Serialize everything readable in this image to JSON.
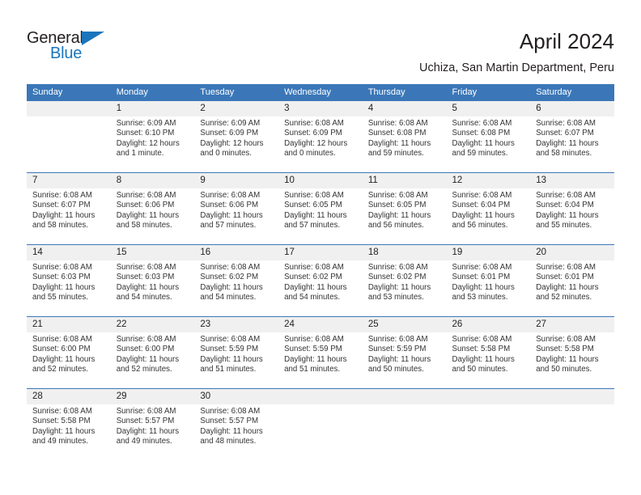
{
  "brand": {
    "name_part1": "General",
    "name_part2": "Blue",
    "triangle_icon": "triangle-icon",
    "accent_color": "#1b75bc"
  },
  "header": {
    "title": "April 2024",
    "subtitle": "Uchiza, San Martin Department, Peru"
  },
  "theme": {
    "header_blue": "#3b77b8",
    "date_band_gray": "#f0f0f0",
    "text_color": "#231f20",
    "body_text": "#333333"
  },
  "calendar": {
    "day_headers": [
      "Sunday",
      "Monday",
      "Tuesday",
      "Wednesday",
      "Thursday",
      "Friday",
      "Saturday"
    ],
    "weeks": [
      {
        "dates": [
          "",
          "1",
          "2",
          "3",
          "4",
          "5",
          "6"
        ],
        "cells": [
          {
            "empty": true,
            "sunrise": "",
            "sunset": "",
            "daylight_line1": "",
            "daylight_line2": ""
          },
          {
            "empty": false,
            "sunrise": "Sunrise: 6:09 AM",
            "sunset": "Sunset: 6:10 PM",
            "daylight_line1": "Daylight: 12 hours",
            "daylight_line2": "and 1 minute."
          },
          {
            "empty": false,
            "sunrise": "Sunrise: 6:09 AM",
            "sunset": "Sunset: 6:09 PM",
            "daylight_line1": "Daylight: 12 hours",
            "daylight_line2": "and 0 minutes."
          },
          {
            "empty": false,
            "sunrise": "Sunrise: 6:08 AM",
            "sunset": "Sunset: 6:09 PM",
            "daylight_line1": "Daylight: 12 hours",
            "daylight_line2": "and 0 minutes."
          },
          {
            "empty": false,
            "sunrise": "Sunrise: 6:08 AM",
            "sunset": "Sunset: 6:08 PM",
            "daylight_line1": "Daylight: 11 hours",
            "daylight_line2": "and 59 minutes."
          },
          {
            "empty": false,
            "sunrise": "Sunrise: 6:08 AM",
            "sunset": "Sunset: 6:08 PM",
            "daylight_line1": "Daylight: 11 hours",
            "daylight_line2": "and 59 minutes."
          },
          {
            "empty": false,
            "sunrise": "Sunrise: 6:08 AM",
            "sunset": "Sunset: 6:07 PM",
            "daylight_line1": "Daylight: 11 hours",
            "daylight_line2": "and 58 minutes."
          }
        ]
      },
      {
        "dates": [
          "7",
          "8",
          "9",
          "10",
          "11",
          "12",
          "13"
        ],
        "cells": [
          {
            "empty": false,
            "sunrise": "Sunrise: 6:08 AM",
            "sunset": "Sunset: 6:07 PM",
            "daylight_line1": "Daylight: 11 hours",
            "daylight_line2": "and 58 minutes."
          },
          {
            "empty": false,
            "sunrise": "Sunrise: 6:08 AM",
            "sunset": "Sunset: 6:06 PM",
            "daylight_line1": "Daylight: 11 hours",
            "daylight_line2": "and 58 minutes."
          },
          {
            "empty": false,
            "sunrise": "Sunrise: 6:08 AM",
            "sunset": "Sunset: 6:06 PM",
            "daylight_line1": "Daylight: 11 hours",
            "daylight_line2": "and 57 minutes."
          },
          {
            "empty": false,
            "sunrise": "Sunrise: 6:08 AM",
            "sunset": "Sunset: 6:05 PM",
            "daylight_line1": "Daylight: 11 hours",
            "daylight_line2": "and 57 minutes."
          },
          {
            "empty": false,
            "sunrise": "Sunrise: 6:08 AM",
            "sunset": "Sunset: 6:05 PM",
            "daylight_line1": "Daylight: 11 hours",
            "daylight_line2": "and 56 minutes."
          },
          {
            "empty": false,
            "sunrise": "Sunrise: 6:08 AM",
            "sunset": "Sunset: 6:04 PM",
            "daylight_line1": "Daylight: 11 hours",
            "daylight_line2": "and 56 minutes."
          },
          {
            "empty": false,
            "sunrise": "Sunrise: 6:08 AM",
            "sunset": "Sunset: 6:04 PM",
            "daylight_line1": "Daylight: 11 hours",
            "daylight_line2": "and 55 minutes."
          }
        ]
      },
      {
        "dates": [
          "14",
          "15",
          "16",
          "17",
          "18",
          "19",
          "20"
        ],
        "cells": [
          {
            "empty": false,
            "sunrise": "Sunrise: 6:08 AM",
            "sunset": "Sunset: 6:03 PM",
            "daylight_line1": "Daylight: 11 hours",
            "daylight_line2": "and 55 minutes."
          },
          {
            "empty": false,
            "sunrise": "Sunrise: 6:08 AM",
            "sunset": "Sunset: 6:03 PM",
            "daylight_line1": "Daylight: 11 hours",
            "daylight_line2": "and 54 minutes."
          },
          {
            "empty": false,
            "sunrise": "Sunrise: 6:08 AM",
            "sunset": "Sunset: 6:02 PM",
            "daylight_line1": "Daylight: 11 hours",
            "daylight_line2": "and 54 minutes."
          },
          {
            "empty": false,
            "sunrise": "Sunrise: 6:08 AM",
            "sunset": "Sunset: 6:02 PM",
            "daylight_line1": "Daylight: 11 hours",
            "daylight_line2": "and 54 minutes."
          },
          {
            "empty": false,
            "sunrise": "Sunrise: 6:08 AM",
            "sunset": "Sunset: 6:02 PM",
            "daylight_line1": "Daylight: 11 hours",
            "daylight_line2": "and 53 minutes."
          },
          {
            "empty": false,
            "sunrise": "Sunrise: 6:08 AM",
            "sunset": "Sunset: 6:01 PM",
            "daylight_line1": "Daylight: 11 hours",
            "daylight_line2": "and 53 minutes."
          },
          {
            "empty": false,
            "sunrise": "Sunrise: 6:08 AM",
            "sunset": "Sunset: 6:01 PM",
            "daylight_line1": "Daylight: 11 hours",
            "daylight_line2": "and 52 minutes."
          }
        ]
      },
      {
        "dates": [
          "21",
          "22",
          "23",
          "24",
          "25",
          "26",
          "27"
        ],
        "cells": [
          {
            "empty": false,
            "sunrise": "Sunrise: 6:08 AM",
            "sunset": "Sunset: 6:00 PM",
            "daylight_line1": "Daylight: 11 hours",
            "daylight_line2": "and 52 minutes."
          },
          {
            "empty": false,
            "sunrise": "Sunrise: 6:08 AM",
            "sunset": "Sunset: 6:00 PM",
            "daylight_line1": "Daylight: 11 hours",
            "daylight_line2": "and 52 minutes."
          },
          {
            "empty": false,
            "sunrise": "Sunrise: 6:08 AM",
            "sunset": "Sunset: 5:59 PM",
            "daylight_line1": "Daylight: 11 hours",
            "daylight_line2": "and 51 minutes."
          },
          {
            "empty": false,
            "sunrise": "Sunrise: 6:08 AM",
            "sunset": "Sunset: 5:59 PM",
            "daylight_line1": "Daylight: 11 hours",
            "daylight_line2": "and 51 minutes."
          },
          {
            "empty": false,
            "sunrise": "Sunrise: 6:08 AM",
            "sunset": "Sunset: 5:59 PM",
            "daylight_line1": "Daylight: 11 hours",
            "daylight_line2": "and 50 minutes."
          },
          {
            "empty": false,
            "sunrise": "Sunrise: 6:08 AM",
            "sunset": "Sunset: 5:58 PM",
            "daylight_line1": "Daylight: 11 hours",
            "daylight_line2": "and 50 minutes."
          },
          {
            "empty": false,
            "sunrise": "Sunrise: 6:08 AM",
            "sunset": "Sunset: 5:58 PM",
            "daylight_line1": "Daylight: 11 hours",
            "daylight_line2": "and 50 minutes."
          }
        ]
      },
      {
        "dates": [
          "28",
          "29",
          "30",
          "",
          "",
          "",
          ""
        ],
        "cells": [
          {
            "empty": false,
            "sunrise": "Sunrise: 6:08 AM",
            "sunset": "Sunset: 5:58 PM",
            "daylight_line1": "Daylight: 11 hours",
            "daylight_line2": "and 49 minutes."
          },
          {
            "empty": false,
            "sunrise": "Sunrise: 6:08 AM",
            "sunset": "Sunset: 5:57 PM",
            "daylight_line1": "Daylight: 11 hours",
            "daylight_line2": "and 49 minutes."
          },
          {
            "empty": false,
            "sunrise": "Sunrise: 6:08 AM",
            "sunset": "Sunset: 5:57 PM",
            "daylight_line1": "Daylight: 11 hours",
            "daylight_line2": "and 48 minutes."
          },
          {
            "empty": true,
            "sunrise": "",
            "sunset": "",
            "daylight_line1": "",
            "daylight_line2": ""
          },
          {
            "empty": true,
            "sunrise": "",
            "sunset": "",
            "daylight_line1": "",
            "daylight_line2": ""
          },
          {
            "empty": true,
            "sunrise": "",
            "sunset": "",
            "daylight_line1": "",
            "daylight_line2": ""
          },
          {
            "empty": true,
            "sunrise": "",
            "sunset": "",
            "daylight_line1": "",
            "daylight_line2": ""
          }
        ]
      }
    ]
  }
}
